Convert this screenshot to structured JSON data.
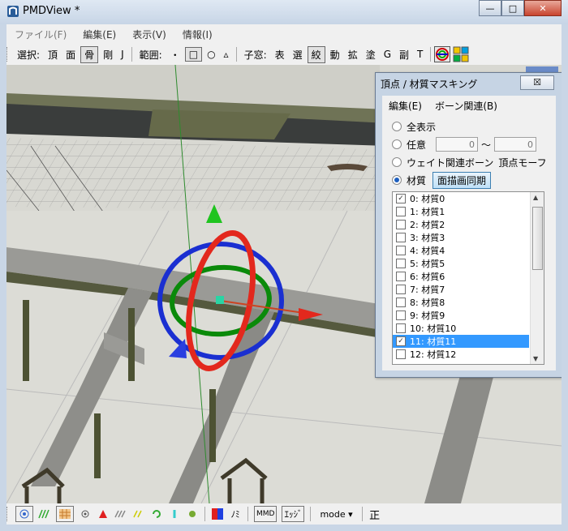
{
  "window": {
    "title": "PMDView *"
  },
  "menu": [
    "ファイル(F)",
    "編集(E)",
    "表示(V)",
    "情報(I)"
  ],
  "toolbar": {
    "select_label": "選択:",
    "select_items": [
      "頂",
      "面",
      "骨",
      "剛",
      "J"
    ],
    "range_label": "範囲:",
    "range_items": [
      "・",
      "□",
      "○",
      "▵"
    ],
    "window_label": "子窓:",
    "window_items": [
      "表",
      "選",
      "絞",
      "動",
      "拡",
      "塗",
      "G",
      "副",
      "T"
    ]
  },
  "dialog": {
    "title": "頂点 / 材質マスキング",
    "close": "☒",
    "menu": [
      "編集(E)",
      "ボーン関連(B)"
    ],
    "opt_all": "全表示",
    "opt_any": "任意",
    "range_from": "0",
    "range_sep": "～",
    "range_to": "0",
    "opt_weight": "ウェイト関連ボーン",
    "opt_vertex_morph": "頂点モーフ",
    "opt_material": "材質",
    "sync_button": "面描画同期",
    "items": [
      {
        "label": "0:  材質0",
        "checked": true
      },
      {
        "label": "1:  材質1",
        "checked": false
      },
      {
        "label": "2:  材質2",
        "checked": false
      },
      {
        "label": "3:  材質3",
        "checked": false
      },
      {
        "label": "4:  材質4",
        "checked": false
      },
      {
        "label": "5:  材質5",
        "checked": false
      },
      {
        "label": "6:  材質6",
        "checked": false
      },
      {
        "label": "7:  材質7",
        "checked": false
      },
      {
        "label": "8:  材質8",
        "checked": false
      },
      {
        "label": "9:  材質9",
        "checked": false
      },
      {
        "label": "10:  材質10",
        "checked": false
      },
      {
        "label": "11:  材質11",
        "checked": true
      },
      {
        "label": "12:  材質12",
        "checked": false
      }
    ]
  },
  "statusbar": {
    "ni_label": "ﾉﾐ",
    "mmd_label": "MMD",
    "edge_label": "ｴｯｼﾞ",
    "mode_label": "mode ▾",
    "sei_label": "正"
  }
}
